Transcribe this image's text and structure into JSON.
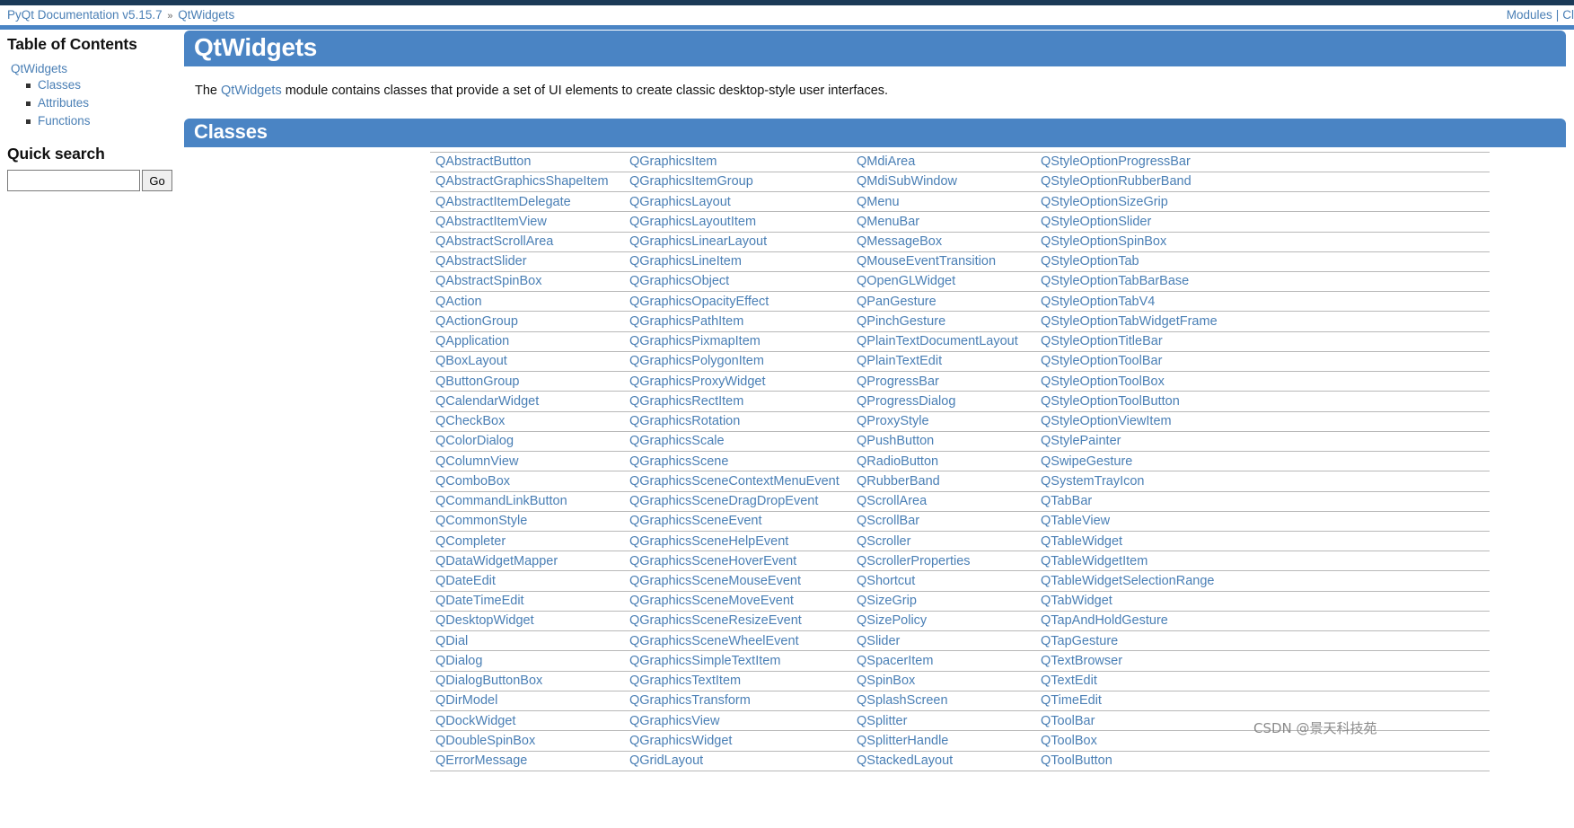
{
  "breadcrumb": {
    "items": [
      {
        "label": "PyQt Documentation v5.15.7",
        "link": true
      },
      {
        "label": "QtWidgets",
        "link": true
      }
    ],
    "separator": "»"
  },
  "top_nav": {
    "modules_label": "Modules",
    "separator": "|",
    "truncated_label": "Cl"
  },
  "sidebar": {
    "toc_title": "Table of Contents",
    "toc_root": "QtWidgets",
    "toc_items": [
      {
        "label": "Classes"
      },
      {
        "label": "Attributes"
      },
      {
        "label": "Functions"
      }
    ],
    "search_title": "Quick search",
    "search_value": "",
    "search_placeholder": "",
    "go_label": "Go"
  },
  "main": {
    "page_title": "QtWidgets",
    "intro_prefix": "The ",
    "intro_link": "QtWidgets",
    "intro_suffix": " module contains classes that provide a set of UI elements to create classic desktop-style user interfaces.",
    "classes_heading": "Classes"
  },
  "class_table": {
    "rows": [
      [
        "QAbstractButton",
        "QGraphicsItem",
        "QMdiArea",
        "QStyleOptionProgressBar"
      ],
      [
        "QAbstractGraphicsShapeItem",
        "QGraphicsItemGroup",
        "QMdiSubWindow",
        "QStyleOptionRubberBand"
      ],
      [
        "QAbstractItemDelegate",
        "QGraphicsLayout",
        "QMenu",
        "QStyleOptionSizeGrip"
      ],
      [
        "QAbstractItemView",
        "QGraphicsLayoutItem",
        "QMenuBar",
        "QStyleOptionSlider"
      ],
      [
        "QAbstractScrollArea",
        "QGraphicsLinearLayout",
        "QMessageBox",
        "QStyleOptionSpinBox"
      ],
      [
        "QAbstractSlider",
        "QGraphicsLineItem",
        "QMouseEventTransition",
        "QStyleOptionTab"
      ],
      [
        "QAbstractSpinBox",
        "QGraphicsObject",
        "QOpenGLWidget",
        "QStyleOptionTabBarBase"
      ],
      [
        "QAction",
        "QGraphicsOpacityEffect",
        "QPanGesture",
        "QStyleOptionTabV4"
      ],
      [
        "QActionGroup",
        "QGraphicsPathItem",
        "QPinchGesture",
        "QStyleOptionTabWidgetFrame"
      ],
      [
        "QApplication",
        "QGraphicsPixmapItem",
        "QPlainTextDocumentLayout",
        "QStyleOptionTitleBar"
      ],
      [
        "QBoxLayout",
        "QGraphicsPolygonItem",
        "QPlainTextEdit",
        "QStyleOptionToolBar"
      ],
      [
        "QButtonGroup",
        "QGraphicsProxyWidget",
        "QProgressBar",
        "QStyleOptionToolBox"
      ],
      [
        "QCalendarWidget",
        "QGraphicsRectItem",
        "QProgressDialog",
        "QStyleOptionToolButton"
      ],
      [
        "QCheckBox",
        "QGraphicsRotation",
        "QProxyStyle",
        "QStyleOptionViewItem"
      ],
      [
        "QColorDialog",
        "QGraphicsScale",
        "QPushButton",
        "QStylePainter"
      ],
      [
        "QColumnView",
        "QGraphicsScene",
        "QRadioButton",
        "QSwipeGesture"
      ],
      [
        "QComboBox",
        "QGraphicsSceneContextMenuEvent",
        "QRubberBand",
        "QSystemTrayIcon"
      ],
      [
        "QCommandLinkButton",
        "QGraphicsSceneDragDropEvent",
        "QScrollArea",
        "QTabBar"
      ],
      [
        "QCommonStyle",
        "QGraphicsSceneEvent",
        "QScrollBar",
        "QTableView"
      ],
      [
        "QCompleter",
        "QGraphicsSceneHelpEvent",
        "QScroller",
        "QTableWidget"
      ],
      [
        "QDataWidgetMapper",
        "QGraphicsSceneHoverEvent",
        "QScrollerProperties",
        "QTableWidgetItem"
      ],
      [
        "QDateEdit",
        "QGraphicsSceneMouseEvent",
        "QShortcut",
        "QTableWidgetSelectionRange"
      ],
      [
        "QDateTimeEdit",
        "QGraphicsSceneMoveEvent",
        "QSizeGrip",
        "QTabWidget"
      ],
      [
        "QDesktopWidget",
        "QGraphicsSceneResizeEvent",
        "QSizePolicy",
        "QTapAndHoldGesture"
      ],
      [
        "QDial",
        "QGraphicsSceneWheelEvent",
        "QSlider",
        "QTapGesture"
      ],
      [
        "QDialog",
        "QGraphicsSimpleTextItem",
        "QSpacerItem",
        "QTextBrowser"
      ],
      [
        "QDialogButtonBox",
        "QGraphicsTextItem",
        "QSpinBox",
        "QTextEdit"
      ],
      [
        "QDirModel",
        "QGraphicsTransform",
        "QSplashScreen",
        "QTimeEdit"
      ],
      [
        "QDockWidget",
        "QGraphicsView",
        "QSplitter",
        "QToolBar"
      ],
      [
        "QDoubleSpinBox",
        "QGraphicsWidget",
        "QSplitterHandle",
        "QToolBox"
      ],
      [
        "QErrorMessage",
        "QGridLayout",
        "QStackedLayout",
        "QToolButton"
      ]
    ]
  },
  "watermark": {
    "text": "CSDN @景天科技苑"
  },
  "colors": {
    "accent": "#4a84c4",
    "dark_strip": "#1b3a57",
    "link": "#4a7fb5",
    "rule": "#b8b8b8"
  }
}
